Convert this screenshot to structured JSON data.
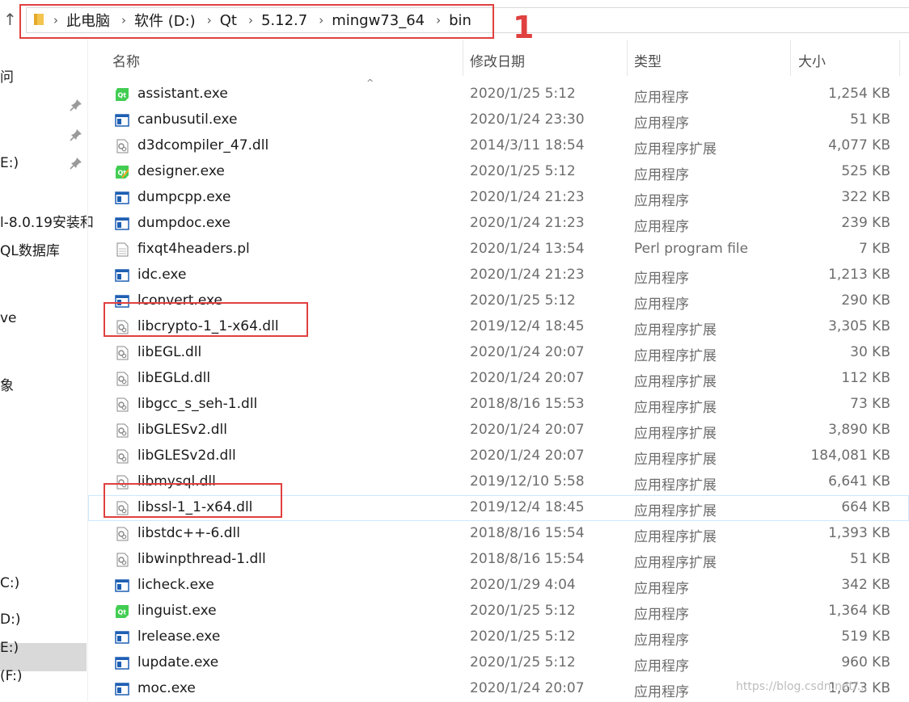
{
  "breadcrumb": [
    "此电脑",
    "软件 (D:)",
    "Qt",
    "5.12.7",
    "mingw73_64",
    "bin"
  ],
  "annotation_label": "1",
  "sidebar": {
    "items": [
      {
        "label": "问",
        "pinned": false
      },
      {
        "label": "",
        "pinned": true
      },
      {
        "label": "",
        "pinned": true
      },
      {
        "label": "E:)",
        "pinned": true
      },
      {
        "label": "l-8.0.19安装和",
        "pinned": false
      },
      {
        "label": "QL数据库",
        "pinned": false
      },
      {
        "label": "ve",
        "pinned": false
      },
      {
        "label": "象",
        "pinned": false
      },
      {
        "label": "C:)",
        "pinned": false
      },
      {
        "label": "D:)",
        "pinned": false,
        "selected": true
      },
      {
        "label": "E:)",
        "pinned": false
      },
      {
        "label": "(F:)",
        "pinned": false
      }
    ]
  },
  "columns": {
    "name": "名称",
    "date": "修改日期",
    "type": "类型",
    "size": "大小"
  },
  "files": [
    {
      "name": "assistant.exe",
      "date": "2020/1/25 5:12",
      "type": "应用程序",
      "size": "1,254 KB",
      "icon": "qt-icon"
    },
    {
      "name": "canbusutil.exe",
      "date": "2020/1/24 23:30",
      "type": "应用程序",
      "size": "51 KB",
      "icon": "exe-icon"
    },
    {
      "name": "d3dcompiler_47.dll",
      "date": "2014/3/11 18:54",
      "type": "应用程序扩展",
      "size": "4,077 KB",
      "icon": "dll-icon"
    },
    {
      "name": "designer.exe",
      "date": "2020/1/25 5:12",
      "type": "应用程序",
      "size": "525 KB",
      "icon": "qt-designer-icon"
    },
    {
      "name": "dumpcpp.exe",
      "date": "2020/1/24 21:23",
      "type": "应用程序",
      "size": "322 KB",
      "icon": "exe-icon"
    },
    {
      "name": "dumpdoc.exe",
      "date": "2020/1/24 21:23",
      "type": "应用程序",
      "size": "239 KB",
      "icon": "exe-icon"
    },
    {
      "name": "fixqt4headers.pl",
      "date": "2020/1/24 13:54",
      "type": "Perl program file",
      "size": "7 KB",
      "icon": "file-icon"
    },
    {
      "name": "idc.exe",
      "date": "2020/1/24 21:23",
      "type": "应用程序",
      "size": "1,213 KB",
      "icon": "exe-icon"
    },
    {
      "name": "lconvert.exe",
      "date": "2020/1/25 5:12",
      "type": "应用程序",
      "size": "290 KB",
      "icon": "exe-icon"
    },
    {
      "name": "libcrypto-1_1-x64.dll",
      "date": "2019/12/4 18:45",
      "type": "应用程序扩展",
      "size": "3,305 KB",
      "icon": "dll-icon",
      "highlight": true
    },
    {
      "name": "libEGL.dll",
      "date": "2020/1/24 20:07",
      "type": "应用程序扩展",
      "size": "30 KB",
      "icon": "dll-icon"
    },
    {
      "name": "libEGLd.dll",
      "date": "2020/1/24 20:07",
      "type": "应用程序扩展",
      "size": "112 KB",
      "icon": "dll-icon"
    },
    {
      "name": "libgcc_s_seh-1.dll",
      "date": "2018/8/16 15:53",
      "type": "应用程序扩展",
      "size": "73 KB",
      "icon": "dll-icon"
    },
    {
      "name": "libGLESv2.dll",
      "date": "2020/1/24 20:07",
      "type": "应用程序扩展",
      "size": "3,890 KB",
      "icon": "dll-icon"
    },
    {
      "name": "libGLESv2d.dll",
      "date": "2020/1/24 20:07",
      "type": "应用程序扩展",
      "size": "184,081 KB",
      "icon": "dll-icon"
    },
    {
      "name": "libmysql.dll",
      "date": "2019/12/10 5:58",
      "type": "应用程序扩展",
      "size": "6,641 KB",
      "icon": "dll-icon"
    },
    {
      "name": "libssl-1_1-x64.dll",
      "date": "2019/12/4 18:45",
      "type": "应用程序扩展",
      "size": "664 KB",
      "icon": "dll-icon",
      "highlight": true,
      "hover": true
    },
    {
      "name": "libstdc++-6.dll",
      "date": "2018/8/16 15:54",
      "type": "应用程序扩展",
      "size": "1,393 KB",
      "icon": "dll-icon"
    },
    {
      "name": "libwinpthread-1.dll",
      "date": "2018/8/16 15:54",
      "type": "应用程序扩展",
      "size": "51 KB",
      "icon": "dll-icon"
    },
    {
      "name": "licheck.exe",
      "date": "2020/1/29 4:04",
      "type": "应用程序",
      "size": "342 KB",
      "icon": "exe-icon"
    },
    {
      "name": "linguist.exe",
      "date": "2020/1/25 5:12",
      "type": "应用程序",
      "size": "1,364 KB",
      "icon": "qt-icon"
    },
    {
      "name": "lrelease.exe",
      "date": "2020/1/25 5:12",
      "type": "应用程序",
      "size": "519 KB",
      "icon": "exe-icon"
    },
    {
      "name": "lupdate.exe",
      "date": "2020/1/25 5:12",
      "type": "应用程序",
      "size": "960 KB",
      "icon": "exe-icon"
    },
    {
      "name": "moc.exe",
      "date": "2020/1/24 20:07",
      "type": "应用程序",
      "size": "1,673 KB",
      "icon": "exe-icon"
    }
  ],
  "watermark": "https://blog.csdn.net/...",
  "colors": {
    "highlight": "#e0403f",
    "selected": "#d9d9d9",
    "hover": "#cce8ff",
    "qt_green": "#41cd52",
    "exe_blue": "#1e5fb3"
  }
}
